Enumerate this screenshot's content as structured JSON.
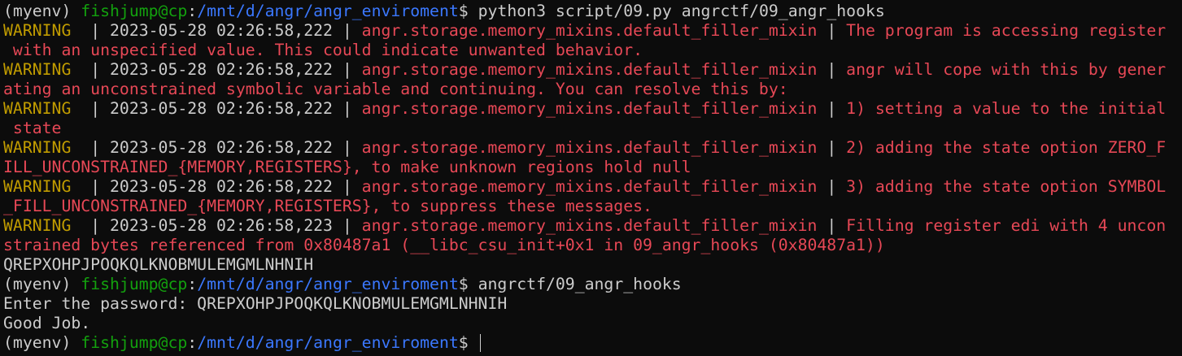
{
  "colors": {
    "background": "#0c0c0c",
    "text": "#cccccc",
    "user_host": "#13a10e",
    "path": "#3b78ff",
    "warning_level": "#c19c00",
    "log_red": "#e74856"
  },
  "prompt": {
    "env": "(myenv) ",
    "user_host": "fishjump@cp",
    "sep": ":",
    "path": "/mnt/d/angr/angr_enviroment",
    "dollar": "$ "
  },
  "commands": {
    "first": "python3 script/09.py angrctf/09_angr_hooks",
    "second": "angrctf/09_angr_hooks"
  },
  "log": {
    "level": "WARNING",
    "level_pad": "WARNING  | ",
    "pipe": " | ",
    "logger": "angr.storage.memory_mixins.default_filler_mixin",
    "entries": [
      {
        "timestamp": "2023-05-28 02:26:58,222",
        "msg_start": "The program is accessing register",
        "msg_cont": " with an unspecified value. This could indicate unwanted behavior."
      },
      {
        "timestamp": "2023-05-28 02:26:58,222",
        "msg_start": "angr will cope with this by gener",
        "msg_cont": "ating an unconstrained symbolic variable and continuing. You can resolve this by:"
      },
      {
        "timestamp": "2023-05-28 02:26:58,222",
        "msg_start": "1) setting a value to the initial",
        "msg_cont": " state"
      },
      {
        "timestamp": "2023-05-28 02:26:58,222",
        "msg_start": "2) adding the state option ZERO_F",
        "msg_cont": "ILL_UNCONSTRAINED_{MEMORY,REGISTERS}, to make unknown regions hold null"
      },
      {
        "timestamp": "2023-05-28 02:26:58,222",
        "msg_start": "3) adding the state option SYMBOL",
        "msg_cont": "_FILL_UNCONSTRAINED_{MEMORY,REGISTERS}, to suppress these messages."
      },
      {
        "timestamp": "2023-05-28 02:26:58,223",
        "msg_start": "Filling register edi with 4 uncon",
        "msg_cont": "strained bytes referenced from 0x80487a1 (__libc_csu_init+0x1 in 09_angr_hooks (0x80487a1))"
      }
    ]
  },
  "output": {
    "solution": "QREPXOHPJPOQKQLKNOBMULEMGMLNHNIH",
    "password_prompt": "Enter the password: QREPXOHPJPOQKQLKNOBMULEMGMLNHNIH",
    "result": "Good Job."
  }
}
